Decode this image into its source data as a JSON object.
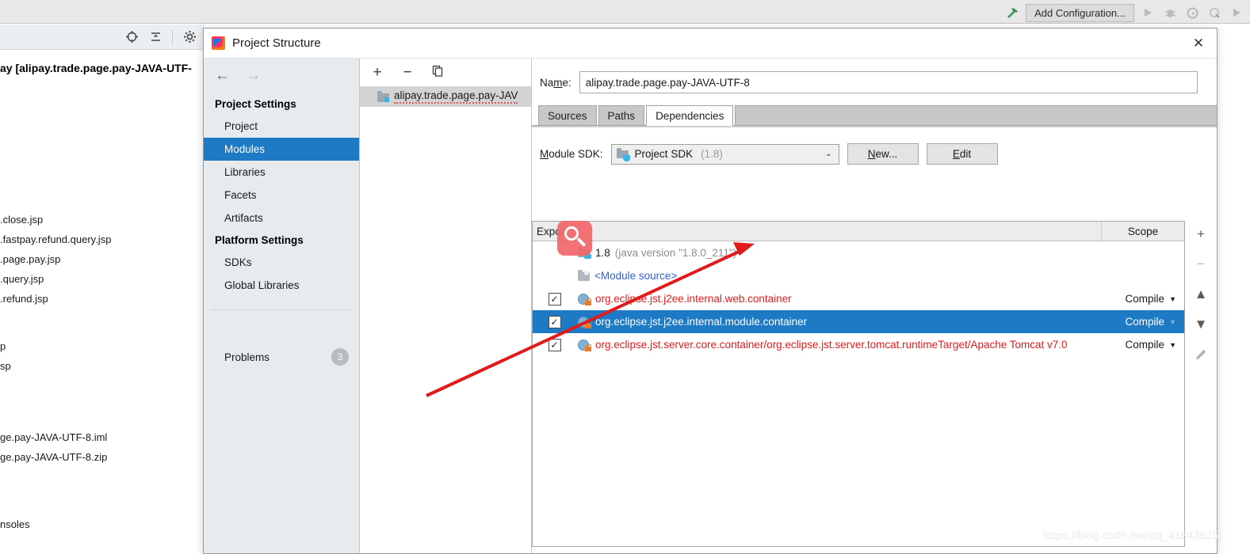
{
  "ide": {
    "toolbar": {
      "hammer_icon": "hammer-icon",
      "add_configuration_label": "Add Configuration...",
      "run_icon": "run-icon",
      "debug_icon": "debug-icon",
      "run_coverage_icon": "run-with-coverage-icon",
      "profile_icon": "profile-icon",
      "run2_icon": "run-secondary-icon"
    },
    "project_toolbar": {
      "locate_icon": "locate-target-icon",
      "collapse_icon": "collapse-all-icon",
      "settings_icon": "gear-icon"
    },
    "project_title": "ay [alipay.trade.page.pay-JAVA-UTF-",
    "files_group_1": [
      ".close.jsp",
      ".fastpay.refund.query.jsp",
      ".page.pay.jsp",
      ".query.jsp",
      ".refund.jsp"
    ],
    "files_group_2": [
      "p",
      "sp"
    ],
    "files_group_3": [
      "ge.pay-JAVA-UTF-8.iml",
      "ge.pay-JAVA-UTF-8.zip"
    ],
    "files_group_4": [
      "nsoles"
    ]
  },
  "dialog": {
    "title": "Project Structure",
    "app_icon": "intellij-idea-icon",
    "close_label": "✕",
    "nav": {
      "back_icon": "arrow-left-icon",
      "forward_icon": "arrow-right-icon"
    },
    "sidebar": {
      "groups": [
        {
          "label": "Project Settings",
          "items": [
            {
              "label": "Project",
              "active": false
            },
            {
              "label": "Modules",
              "active": true
            },
            {
              "label": "Libraries",
              "active": false
            },
            {
              "label": "Facets",
              "active": false
            },
            {
              "label": "Artifacts",
              "active": false
            }
          ]
        },
        {
          "label": "Platform Settings",
          "items": [
            {
              "label": "SDKs",
              "active": false
            },
            {
              "label": "Global Libraries",
              "active": false
            }
          ]
        }
      ],
      "problems_label": "Problems",
      "problems_count": "3"
    },
    "modules": {
      "toolbar": {
        "add_label": "+",
        "remove_label": "−",
        "copy_icon": "copy-icon"
      },
      "tree": [
        {
          "label": "alipay.trade.page.pay-JAV",
          "icon": "module-folder-icon",
          "selected": true
        }
      ]
    },
    "details": {
      "name_label": "Name:",
      "name_value": "alipay.trade.page.pay-JAVA-UTF-8",
      "tabs": [
        {
          "label": "Sources",
          "active": false
        },
        {
          "label": "Paths",
          "active": false
        },
        {
          "label": "Dependencies",
          "active": true
        }
      ],
      "module_sdk_label": "Module SDK:",
      "module_sdk_value": "Project SDK",
      "module_sdk_version": "(1.8)",
      "module_sdk_caret": "⌄",
      "new_button": "New...",
      "edit_button": "Edit",
      "table": {
        "columns": [
          "Export",
          "Scope"
        ],
        "rows": [
          {
            "export": null,
            "checked": false,
            "icon": "jdk-icon",
            "name": "1.8",
            "name_suffix": "(java version \"1.8.0_211\")",
            "name_color": "black",
            "scope": "",
            "selected": false
          },
          {
            "export": null,
            "checked": false,
            "icon": "module-source-icon",
            "name": "<Module source>",
            "name_suffix": "",
            "name_color": "blue",
            "scope": "",
            "selected": false
          },
          {
            "export": true,
            "checked": true,
            "icon": "library-locked-icon",
            "name": "org.eclipse.jst.j2ee.internal.web.container",
            "name_suffix": "",
            "name_color": "red",
            "scope": "Compile",
            "selected": false
          },
          {
            "export": true,
            "checked": true,
            "icon": "library-locked-icon",
            "name": "org.eclipse.jst.j2ee.internal.module.container",
            "name_suffix": "",
            "name_color": "white",
            "scope": "Compile",
            "selected": true
          },
          {
            "export": true,
            "checked": true,
            "icon": "library-locked-icon",
            "name": "org.eclipse.jst.server.core.container/org.eclipse.jst.server.tomcat.runtimeTarget/Apache Tomcat v7.0",
            "name_suffix": "",
            "name_color": "red",
            "scope": "Compile",
            "selected": false
          }
        ],
        "side_buttons": [
          {
            "icon": "add-icon",
            "label": "+",
            "dim": false
          },
          {
            "icon": "remove-icon",
            "label": "−",
            "dim": true
          },
          {
            "icon": "move-up-icon",
            "label": "▲",
            "dim": false
          },
          {
            "icon": "move-down-icon",
            "label": "▼",
            "dim": false
          },
          {
            "icon": "edit-pencil-icon",
            "label": "✎",
            "dim": true
          }
        ]
      }
    }
  },
  "overlay": {
    "magnifier_icon": "magnifier-cursor-icon",
    "annotation_arrow": "red-annotation-arrow",
    "arrow_color": "#e01b1b",
    "watermark": "https://blog.csdn.net/qq_41843925"
  },
  "colors": {
    "selection_blue": "#1e7ac4",
    "dialog_bg": "#ffffff",
    "sidebar_bg": "#e8ebed",
    "link_red": "#e01b1b",
    "link_blue": "#2b5fd9"
  }
}
